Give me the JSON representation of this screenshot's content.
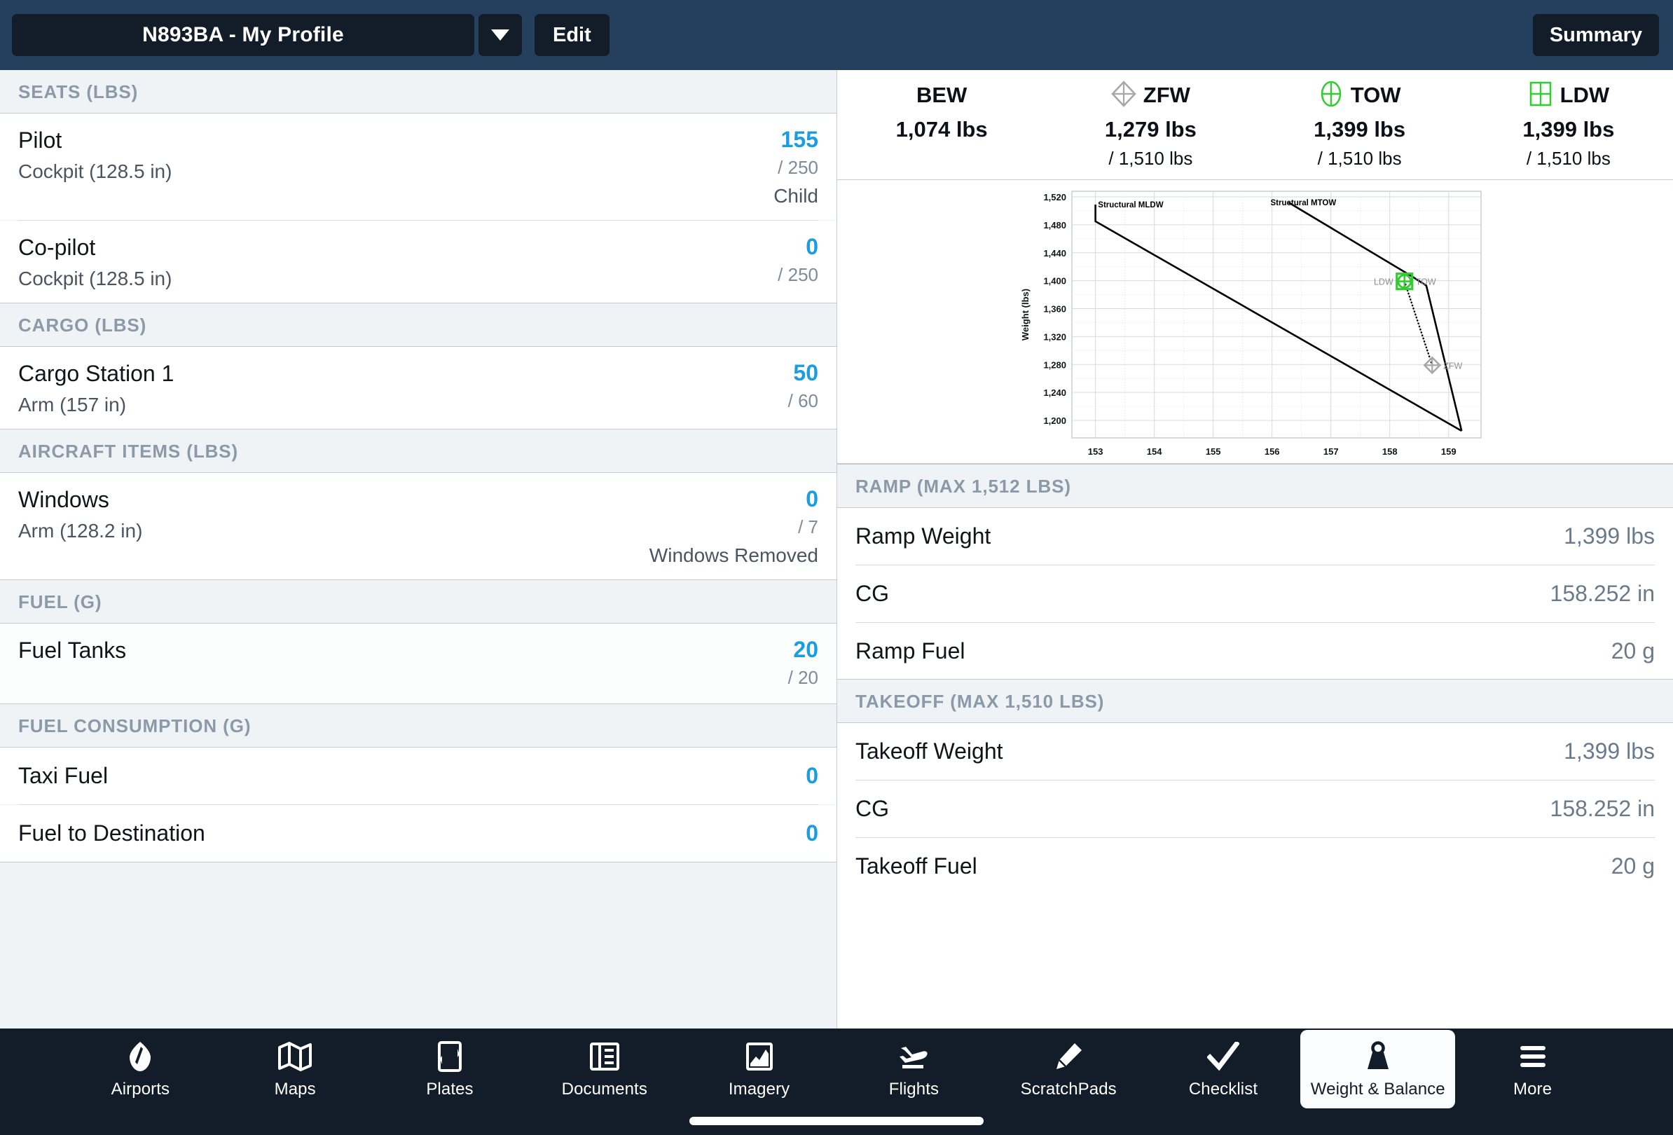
{
  "topbar": {
    "profile_label": "N893BA - My Profile",
    "caret_icon": "chevron-down-icon",
    "edit_label": "Edit",
    "summary_label": "Summary"
  },
  "left_panel": {
    "sections": [
      {
        "id": "seats",
        "header": "SEATS (LBS)",
        "rows": [
          {
            "title": "Pilot",
            "sub": "Cockpit (128.5 in)",
            "value": "155",
            "max": "/ 250",
            "note": "Child"
          },
          {
            "title": "Co-pilot",
            "sub": "Cockpit (128.5 in)",
            "value": "0",
            "max": "/ 250",
            "note": ""
          }
        ]
      },
      {
        "id": "cargo",
        "header": "CARGO (LBS)",
        "rows": [
          {
            "title": "Cargo Station 1",
            "sub": "Arm (157 in)",
            "value": "50",
            "max": "/ 60",
            "note": ""
          }
        ]
      },
      {
        "id": "aircraft-items",
        "header": "AIRCRAFT ITEMS (LBS)",
        "rows": [
          {
            "title": "Windows",
            "sub": "Arm (128.2 in)",
            "value": "0",
            "max": "/ 7",
            "note": "Windows Removed"
          }
        ]
      },
      {
        "id": "fuel",
        "header": "FUEL (G)",
        "rows": [
          {
            "title": "Fuel Tanks",
            "sub": "",
            "value": "20",
            "max": "/ 20",
            "note": ""
          }
        ]
      },
      {
        "id": "fuel-consumption",
        "header": "FUEL CONSUMPTION (G)",
        "rows": [
          {
            "title": "Taxi Fuel",
            "sub": "",
            "value": "0",
            "max": "",
            "note": ""
          },
          {
            "title": "Fuel to Destination",
            "sub": "",
            "value": "0",
            "max": "",
            "note": ""
          }
        ]
      }
    ]
  },
  "weight_summary": [
    {
      "icon": "none",
      "label": "BEW",
      "value": "1,074 lbs",
      "max": ""
    },
    {
      "icon": "diamond-cross-icon",
      "label": "ZFW",
      "value": "1,279 lbs",
      "max": "/ 1,510 lbs"
    },
    {
      "icon": "circle-cross-icon",
      "label": "TOW",
      "value": "1,399 lbs",
      "max": "/ 1,510 lbs"
    },
    {
      "icon": "square-grid-icon",
      "label": "LDW",
      "value": "1,399 lbs",
      "max": "/ 1,510 lbs"
    }
  ],
  "right_panel": {
    "sections": [
      {
        "id": "ramp",
        "header": "RAMP (MAX 1,512 LBS)",
        "rows": [
          {
            "label": "Ramp Weight",
            "value": "1,399 lbs"
          },
          {
            "label": "CG",
            "value": "158.252 in"
          },
          {
            "label": "Ramp Fuel",
            "value": "20 g"
          }
        ]
      },
      {
        "id": "takeoff",
        "header": "TAKEOFF (MAX 1,510 LBS)",
        "rows": [
          {
            "label": "Takeoff Weight",
            "value": "1,399 lbs"
          },
          {
            "label": "CG",
            "value": "158.252 in"
          },
          {
            "label": "Takeoff Fuel",
            "value": "20 g"
          }
        ]
      }
    ]
  },
  "chart_data": {
    "type": "line",
    "title": "",
    "xlabel": "",
    "ylabel": "Weight (lbs)",
    "xlim": [
      152.6,
      159.55
    ],
    "ylim": [
      1175,
      1528
    ],
    "xticks": [
      153,
      154,
      155,
      156,
      157,
      158,
      159
    ],
    "yticks": [
      1200,
      1240,
      1280,
      1320,
      1360,
      1400,
      1440,
      1480,
      1520
    ],
    "grid": true,
    "legend_position": "inline-annotations",
    "annotations": [
      {
        "text": "Structural MLDW",
        "x": 153.02,
        "y": 1509
      },
      {
        "text": "Structural MTOW",
        "x": 155.95,
        "y": 1512
      }
    ],
    "series": [
      {
        "name": "Structural MLDW envelope",
        "style": "solid",
        "points": [
          {
            "x": 153.0,
            "y": 1509
          },
          {
            "x": 153.0,
            "y": 1485
          },
          {
            "x": 159.22,
            "y": 1185
          }
        ]
      },
      {
        "name": "Structural MTOW envelope",
        "style": "solid",
        "points": [
          {
            "x": 156.28,
            "y": 1512
          },
          {
            "x": 158.38,
            "y": 1406
          },
          {
            "x": 158.62,
            "y": 1393
          },
          {
            "x": 159.22,
            "y": 1185
          }
        ]
      },
      {
        "name": "CG shift line",
        "style": "dotted",
        "points": [
          {
            "x": 158.25,
            "y": 1399
          },
          {
            "x": 158.72,
            "y": 1279
          }
        ]
      }
    ],
    "markers": [
      {
        "name": "LDW",
        "label": "LDW",
        "label_side": "left",
        "icon": "square-grid-icon",
        "color": "#33cc33",
        "x": 158.25,
        "y": 1399
      },
      {
        "name": "TOW",
        "label": "TOW",
        "label_side": "right",
        "icon": "circle-cross-icon",
        "color": "#33cc33",
        "x": 158.25,
        "y": 1399
      },
      {
        "name": "ZFW",
        "label": "ZFW",
        "label_side": "right",
        "icon": "diamond-cross-icon",
        "color": "#a8a8a8",
        "x": 158.72,
        "y": 1279
      }
    ]
  },
  "tabbar": {
    "tabs": [
      {
        "label": "Airports",
        "icon": "compass-icon",
        "active": false
      },
      {
        "label": "Maps",
        "icon": "map-icon",
        "active": false
      },
      {
        "label": "Plates",
        "icon": "plate-icon",
        "active": false
      },
      {
        "label": "Documents",
        "icon": "documents-icon",
        "active": false
      },
      {
        "label": "Imagery",
        "icon": "imagery-icon",
        "active": false
      },
      {
        "label": "Flights",
        "icon": "plane-landing-icon",
        "active": false
      },
      {
        "label": "ScratchPads",
        "icon": "pencil-icon",
        "active": false
      },
      {
        "label": "Checklist",
        "icon": "checkmark-icon",
        "active": false
      },
      {
        "label": "Weight & Balance",
        "icon": "weight-icon",
        "active": true
      },
      {
        "label": "More",
        "icon": "hamburger-icon",
        "active": false
      }
    ]
  },
  "colors": {
    "accent_blue": "#1a9ee0",
    "topbar_navy": "#24405c",
    "tabbar_navy": "#131c29",
    "marker_green": "#33cc33",
    "marker_gray": "#a8a8a8",
    "section_header_text": "#8b99a8"
  }
}
